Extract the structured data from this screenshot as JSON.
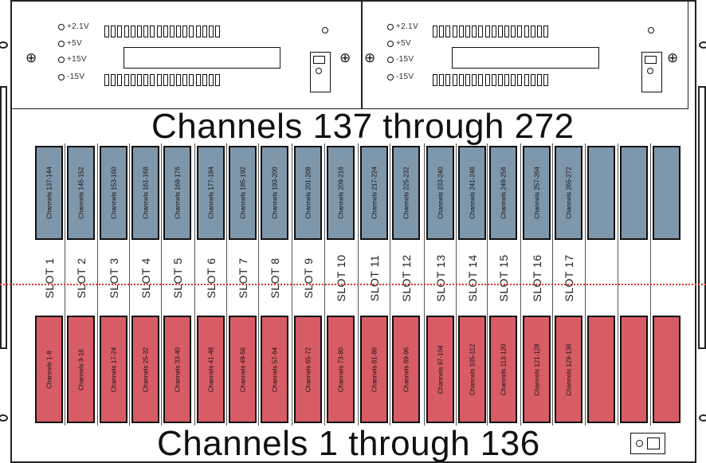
{
  "power_supplies": [
    {
      "voltages": [
        "+2.1V",
        "+5V",
        "+15V",
        "-15V"
      ],
      "connector_pins": 18
    },
    {
      "voltages": [
        "+2.1V",
        "+5V",
        "-15V",
        "-15V"
      ],
      "connector_pins": 18
    }
  ],
  "top_title": "Channels 137  through 272",
  "bottom_title": "Channels 1 through 136",
  "colors": {
    "top_cards": "#7f97ab",
    "bottom_cards": "#d85c66",
    "center_line": "#e0342b"
  },
  "top_cards": [
    "Channels 137-144",
    "Channels 145-152",
    "Channels 153-160",
    "Channels 161-168",
    "Channels 169-176",
    "Channels 177-184",
    "Channels 185-192",
    "Channels 193-200",
    "Channels 201-208",
    "Channels 209-216",
    "Channels 217-224",
    "Channels 225-232",
    "Channels 233-240",
    "Channels 241-248",
    "Channels 249-256",
    "Channels 257-264",
    "Channels 265-272",
    "",
    "",
    ""
  ],
  "slots": [
    "SLOT 1",
    "SLOT 2",
    "SLOT 3",
    "SLOT 4",
    "SLOT 5",
    "SLOT 6",
    "SLOT 7",
    "SLOT 8",
    "SLOT 9",
    "SLOT 10",
    "SLOT 11",
    "SLOT 12",
    "SLOT 13",
    "SLOT 14",
    "SLOT 15",
    "SLOT 16",
    "SLOT 17",
    "",
    "",
    ""
  ],
  "bottom_cards": [
    "Channels 1-8",
    "Channels 9-16",
    "Channels 17-24",
    "Channels 25-32",
    "Channels 33-40",
    "Channels 41-48",
    "Channels 49-56",
    "Channels 57-64",
    "Channels 65-72",
    "Channels 73-80",
    "Channels 81-88",
    "Channels 89-96",
    "Channels 97-104",
    "Channels 105-112",
    "Channels 113-120",
    "Channels 121-128",
    "Channels 129-136",
    "",
    "",
    ""
  ]
}
